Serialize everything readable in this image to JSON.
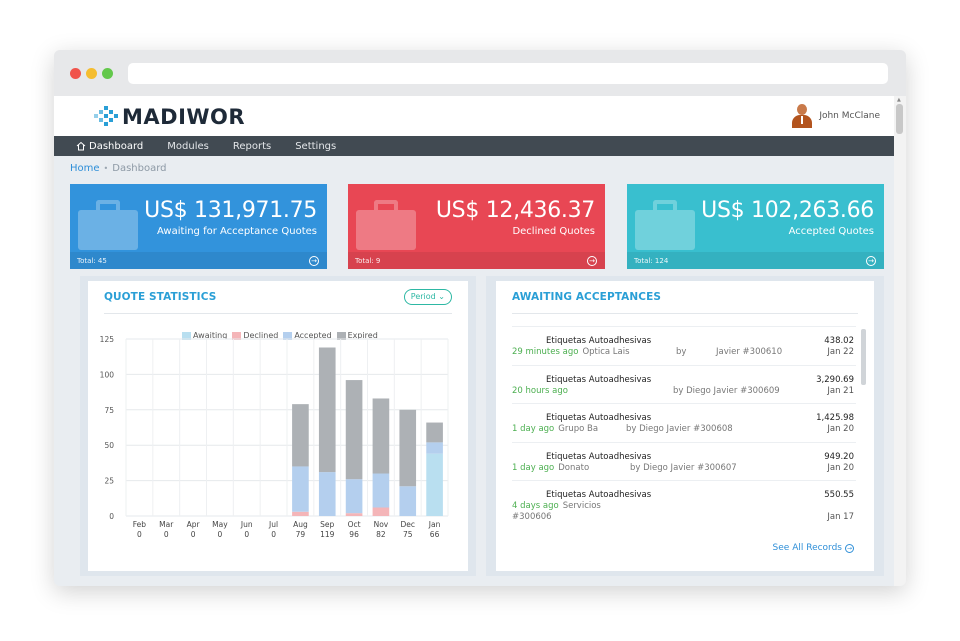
{
  "brand": {
    "name": "MADIWOR"
  },
  "user": {
    "name": "John McClane"
  },
  "nav": {
    "items": [
      {
        "label": "Dashboard",
        "active": true
      },
      {
        "label": "Modules"
      },
      {
        "label": "Reports"
      },
      {
        "label": "Settings"
      }
    ]
  },
  "breadcrumb": {
    "home": "Home",
    "separator": "•",
    "current": "Dashboard"
  },
  "stats": [
    {
      "amount": "US$ 131,971.75",
      "label": "Awaiting for Acceptance Quotes",
      "total": "Total: 45",
      "color": "#3293dc"
    },
    {
      "amount": "US$ 12,436.37",
      "label": "Declined Quotes",
      "total": "Total: 9",
      "color": "#e84754"
    },
    {
      "amount": "US$ 102,263.66",
      "label": "Accepted Quotes",
      "total": "Total: 124",
      "color": "#39bfcf"
    }
  ],
  "quote_statistics": {
    "title": "QUOTE STATISTICS",
    "period_button": "Period",
    "legend": [
      {
        "name": "Awaiting",
        "color": "#b9dff0"
      },
      {
        "name": "Declined",
        "color": "#f4b5b8"
      },
      {
        "name": "Accepted",
        "color": "#b4cfee"
      },
      {
        "name": "Expired",
        "color": "#adb1b5"
      }
    ]
  },
  "chart_data": {
    "type": "bar",
    "stacked": true,
    "categories": [
      "Feb",
      "Mar",
      "Apr",
      "May",
      "Jun",
      "Jul",
      "Aug",
      "Sep",
      "Oct",
      "Nov",
      "Dec",
      "Jan"
    ],
    "totals": [
      "0",
      "0",
      "0",
      "0",
      "0",
      "0",
      "79",
      "119",
      "96",
      "82",
      "75",
      "66"
    ],
    "series": [
      {
        "name": "Awaiting",
        "values": [
          0,
          0,
          0,
          0,
          0,
          0,
          0,
          0,
          0,
          0,
          0,
          44
        ]
      },
      {
        "name": "Declined",
        "values": [
          0,
          0,
          0,
          0,
          0,
          0,
          3,
          0,
          2,
          6,
          0,
          0
        ]
      },
      {
        "name": "Accepted",
        "values": [
          0,
          0,
          0,
          0,
          0,
          0,
          32,
          31,
          24,
          24,
          21,
          8
        ]
      },
      {
        "name": "Expired",
        "values": [
          0,
          0,
          0,
          0,
          0,
          0,
          44,
          88,
          70,
          53,
          54,
          14
        ]
      }
    ],
    "yticks": [
      0,
      25,
      50,
      75,
      100,
      125
    ],
    "ylim": [
      0,
      125
    ],
    "grid": true,
    "legend_position": "top-center"
  },
  "awaiting": {
    "title": "AWAITING ACCEPTANCES",
    "records": [
      {
        "title": "Etiquetas Autoadhesivas",
        "time": "29 minutes ago",
        "client": "Optica Lais",
        "by": "by",
        "author": "Javier #300610",
        "amount": "438.02",
        "date": "Jan 22"
      },
      {
        "title": "Etiquetas Autoadhesivas",
        "time": "20 hours ago",
        "client": "",
        "by": "by Diego Javier #300609",
        "author": "",
        "amount": "3,290.69",
        "date": "Jan 21"
      },
      {
        "title": "Etiquetas Autoadhesivas",
        "time": "1 day ago",
        "client": "Grupo Ba",
        "by": "by Diego Javier #300608",
        "author": "",
        "amount": "1,425.98",
        "date": "Jan 20"
      },
      {
        "title": "Etiquetas Autoadhesivas",
        "time": "1 day ago",
        "client": "Donato",
        "by": "by Diego Javier #300607",
        "author": "",
        "amount": "949.20",
        "date": "Jan 20"
      },
      {
        "title": "Etiquetas Autoadhesivas",
        "time": "4 days ago",
        "client": "Servicios",
        "by": "#300606",
        "author": "",
        "amount": "550.55",
        "date": "Jan 17"
      }
    ],
    "see_all": "See All Records"
  }
}
